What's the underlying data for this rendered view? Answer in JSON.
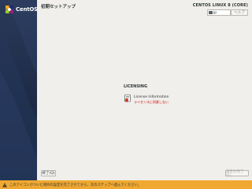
{
  "sidebar": {
    "brand": "CentOS"
  },
  "header": {
    "title": "初期セットアップ",
    "product": "CENTOS LINUX 8 (CORE)",
    "keyboard_layout": "jp",
    "help_label": "ヘルプ"
  },
  "main": {
    "section_title": "LICENSING",
    "spokes": [
      {
        "title": "License Information",
        "status": "ライセンスに同意しない",
        "icon": "license-document-icon"
      }
    ]
  },
  "footer": {
    "quit_label": "終了(Q)",
    "finish_label": "設定の完了(F)"
  },
  "warning": {
    "text": "このアイコンがついた項目の設定を完了させてから、次のステップへ進んでください。"
  },
  "colors": {
    "sidebar": "#1d2b47",
    "background": "#f0efeb",
    "warning_bar": "#f0a830",
    "status_error": "#cc0000"
  }
}
